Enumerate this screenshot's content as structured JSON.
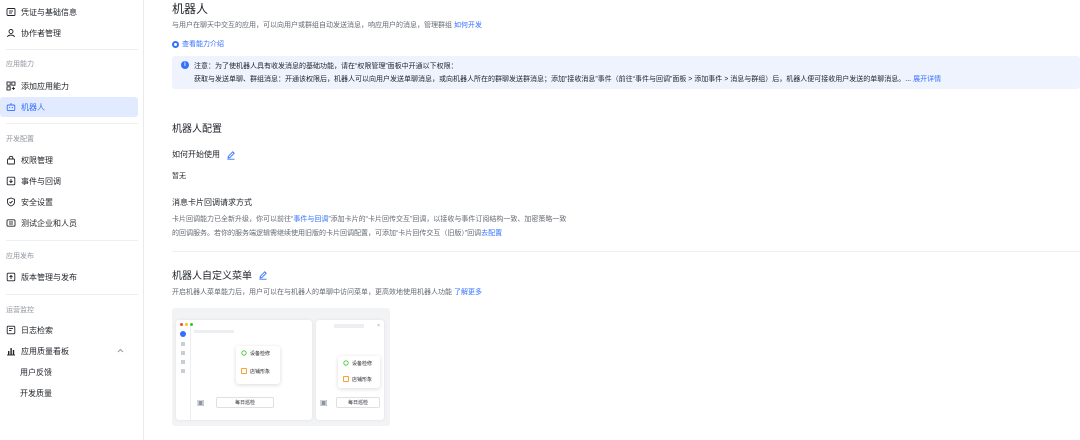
{
  "sidebar": {
    "items": [
      {
        "label": "凭证与基础信息"
      },
      {
        "label": "协作者管理"
      }
    ],
    "sections": {
      "app_ability": "应用能力",
      "dev_config": "开发配置",
      "app_publish": "应用发布",
      "ops_monitor": "运营监控"
    },
    "app_ability_items": [
      {
        "label": "添加应用能力"
      },
      {
        "label": "机器人"
      }
    ],
    "dev_config_items": [
      {
        "label": "权限管理"
      },
      {
        "label": "事件与回调"
      },
      {
        "label": "安全设置"
      },
      {
        "label": "测试企业和人员"
      }
    ],
    "publish_items": [
      {
        "label": "版本管理与发布"
      }
    ],
    "ops_items": [
      {
        "label": "日志检索"
      },
      {
        "label": "应用质量看板"
      }
    ],
    "ops_sub_items": [
      {
        "label": "用户反馈"
      },
      {
        "label": "开发质量"
      }
    ]
  },
  "main": {
    "title": "机器人",
    "description": "与用户在聊天中交互的应用，可以向用户或群组自动发送消息，响应用户的消息，管理群组",
    "how_to_dev_link": "如何开发",
    "capability_link": "查看能力介绍",
    "notice": {
      "line1": "注意：为了使机器人具有收发消息的基础功能，请在“权限管理”面板中开通以下权限：",
      "line2": "获取与发送单聊、群组消息：开通该权限后，机器人可以向用户发送单聊消息，或向机器人所在的群聊发送群消息；添加“接收消息”事件（前往“事件与回调”面板 > 添加事件 > 消息与群组）后，机器人便可接收用户发送的单聊消息。...",
      "expand_link": "展开详情"
    },
    "config": {
      "title": "机器人配置",
      "how_to_use_title": "如何开始使用",
      "how_to_use_value": "暂无",
      "card_callback_title": "消息卡片回调请求方式",
      "card_desc_1_a": "卡片回调能力已全新升级，你可以前往“",
      "card_desc_1_link": "事件与回调",
      "card_desc_1_b": "”添加卡片的“卡片回传交互”回调，以接收与事件订阅结构一致、加密策略一致",
      "card_desc_2_a": "的回调服务。若你的服务端逻辑需继续使用旧版的卡片回调配置，可添加“卡片回传交互（旧版）”回调",
      "card_desc_2_link": "去配置"
    },
    "menu": {
      "title": "机器人自定义菜单",
      "desc": "开启机器人菜单能力后，用户可以在与机器人的单聊中访问菜单，更高效地使用机器人功能",
      "learn_more": "了解更多",
      "preview": {
        "item1": "设备检修",
        "item2": "店铺形象",
        "bottom_btn": "每日巡检"
      }
    }
  }
}
